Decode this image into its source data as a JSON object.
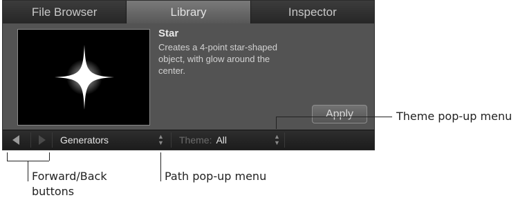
{
  "tabs": [
    {
      "label": "File Browser",
      "active": false
    },
    {
      "label": "Library",
      "active": true
    },
    {
      "label": "Inspector",
      "active": false
    }
  ],
  "item": {
    "title": "Star",
    "description": "Creates a 4-point star-shaped object, with glow around the center."
  },
  "apply_label": "Apply",
  "path_bar": {
    "path_value": "Generators",
    "theme_label": "Theme:",
    "theme_value": "All"
  },
  "callouts": {
    "theme_popup": "Theme pop-up menu",
    "nav_buttons_line1": "Forward/Back",
    "nav_buttons_line2": "buttons",
    "path_popup": "Path pop-up menu"
  },
  "icons": [
    "back-arrow-icon",
    "forward-arrow-icon",
    "stepper-icon"
  ],
  "colors": {
    "panel_bg": "#535353",
    "tab_bar": "#2b2b2b",
    "active_tab": "#6a6a6a",
    "preview_bg": "#000000"
  }
}
